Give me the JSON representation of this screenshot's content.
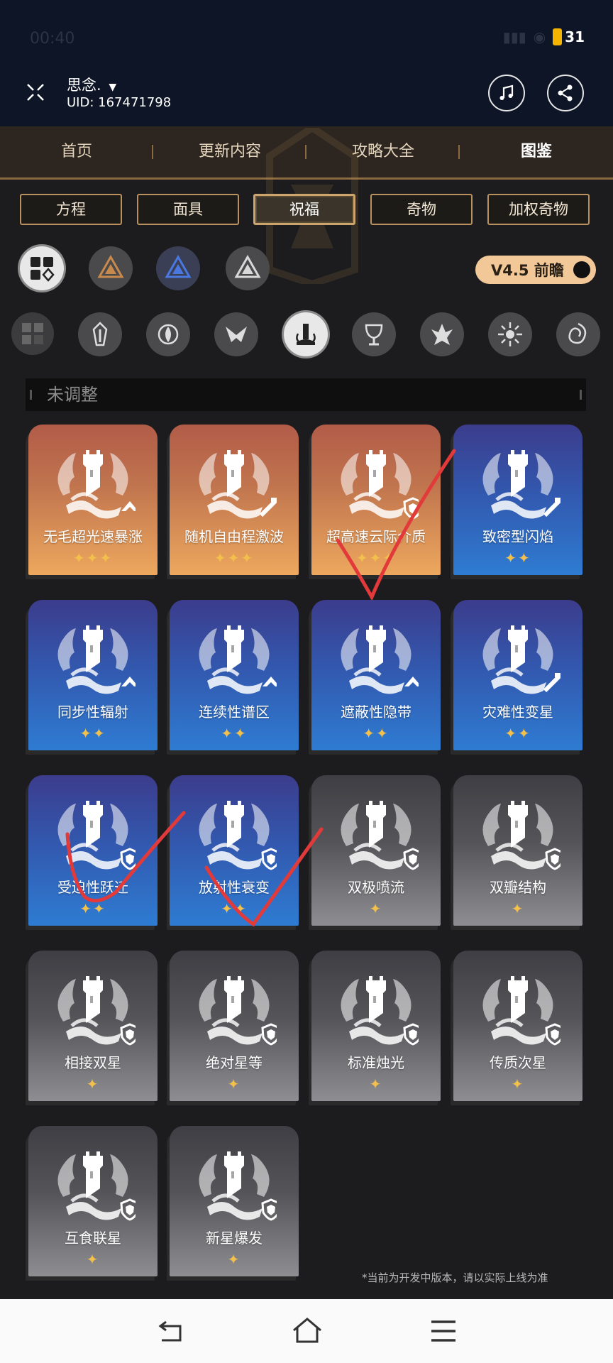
{
  "status": {
    "time": "00:40",
    "battery": "31"
  },
  "header": {
    "user_name": "思念.",
    "uid": "UID: 167471798"
  },
  "nav_tabs": [
    {
      "label": "首页"
    },
    {
      "label": "更新内容"
    },
    {
      "label": "攻略大全"
    },
    {
      "label": "图鉴",
      "active": true
    }
  ],
  "category_tabs": [
    {
      "label": "方程"
    },
    {
      "label": "面具"
    },
    {
      "label": "祝福",
      "active": true
    },
    {
      "label": "奇物"
    },
    {
      "label": "加权奇物"
    }
  ],
  "version_toggle": {
    "label": "V4.5 前瞻",
    "enabled": true
  },
  "filter_rows": {
    "rarity_icons": [
      "all-icon",
      "bronze-path-icon",
      "blue-path-icon",
      "silver-path-icon"
    ],
    "path_icons": [
      "all-icon",
      "preservation-icon",
      "remembrance-icon",
      "nihility-icon",
      "abundance-icon",
      "hunt-icon",
      "destruction-icon",
      "elation-icon",
      "propagation-icon"
    ]
  },
  "section": {
    "title": "未调整"
  },
  "cards": [
    {
      "name": "无毛超光速暴涨",
      "stars": 3,
      "tier": "orange",
      "badge": "arrow-up"
    },
    {
      "name": "随机自由程激波",
      "stars": 3,
      "tier": "orange",
      "badge": "sword"
    },
    {
      "name": "超高速云际介质",
      "stars": 3,
      "tier": "orange",
      "badge": "shield"
    },
    {
      "name": "致密型闪焰",
      "stars": 2,
      "tier": "blue",
      "badge": "sword"
    },
    {
      "name": "同步性辐射",
      "stars": 2,
      "tier": "blue",
      "badge": "arrow-up"
    },
    {
      "name": "连续性谱区",
      "stars": 2,
      "tier": "blue",
      "badge": "arrow-up"
    },
    {
      "name": "遮蔽性隐带",
      "stars": 2,
      "tier": "blue",
      "badge": "arrow-up"
    },
    {
      "name": "灾难性变星",
      "stars": 2,
      "tier": "blue",
      "badge": "sword"
    },
    {
      "name": "受迫性跃迁",
      "stars": 2,
      "tier": "blue",
      "badge": "shield"
    },
    {
      "name": "放射性衰变",
      "stars": 2,
      "tier": "blue",
      "badge": "shield"
    },
    {
      "name": "双极喷流",
      "stars": 1,
      "tier": "gray",
      "badge": "shield"
    },
    {
      "name": "双瓣结构",
      "stars": 1,
      "tier": "gray",
      "badge": "shield"
    },
    {
      "name": "相接双星",
      "stars": 1,
      "tier": "gray",
      "badge": "shield"
    },
    {
      "name": "绝对星等",
      "stars": 1,
      "tier": "gray",
      "badge": "shield"
    },
    {
      "name": "标准烛光",
      "stars": 1,
      "tier": "gray",
      "badge": "shield"
    },
    {
      "name": "传质次星",
      "stars": 1,
      "tier": "gray",
      "badge": "shield"
    },
    {
      "name": "互食联星",
      "stars": 1,
      "tier": "gray",
      "badge": "shield"
    },
    {
      "name": "新星爆发",
      "stars": 1,
      "tier": "gray",
      "badge": "shield"
    }
  ],
  "annotations": [
    "checkmark",
    "checkmark",
    "checkmark"
  ],
  "footnote": "*当前为开发中版本，请以实际上线为准",
  "bottom_nav": {
    "icons": [
      "back-icon",
      "home-icon",
      "menu-icon"
    ]
  }
}
